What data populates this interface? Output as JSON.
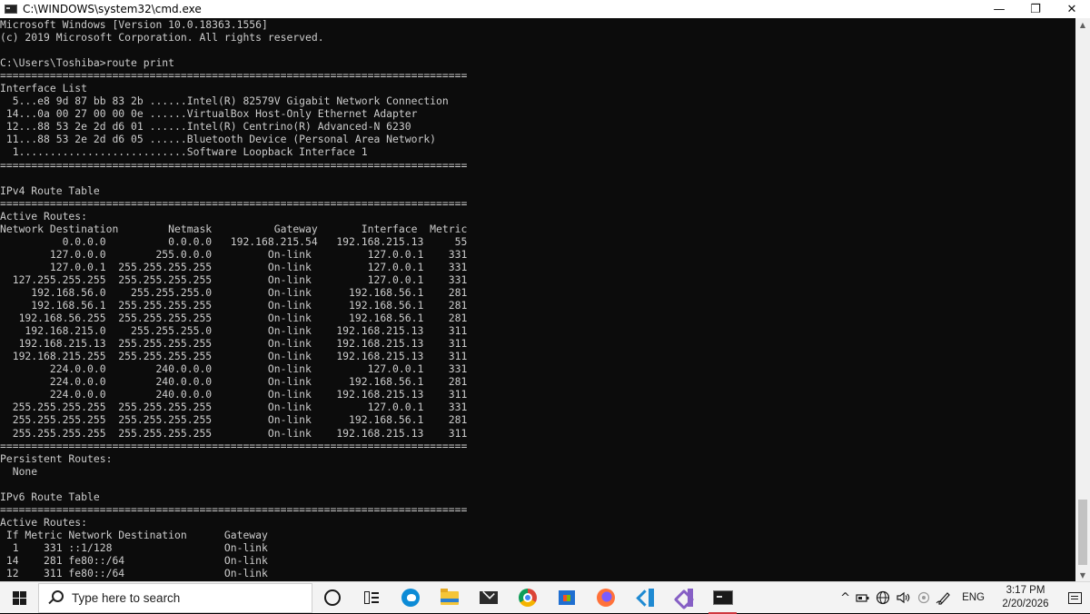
{
  "window": {
    "title": "C:\\WINDOWS\\system32\\cmd.exe",
    "controls": {
      "minimize": "—",
      "restore": "❐",
      "close": "✕"
    }
  },
  "console": {
    "lines": [
      "Microsoft Windows [Version 10.0.18363.1556]",
      "(c) 2019 Microsoft Corporation. All rights reserved.",
      "",
      "C:\\Users\\Toshiba>route print",
      "===========================================================================",
      "Interface List",
      "  5...e8 9d 87 bb 83 2b ......Intel(R) 82579V Gigabit Network Connection",
      " 14...0a 00 27 00 00 0e ......VirtualBox Host-Only Ethernet Adapter",
      " 12...88 53 2e 2d d6 01 ......Intel(R) Centrino(R) Advanced-N 6230",
      " 11...88 53 2e 2d d6 05 ......Bluetooth Device (Personal Area Network)",
      "  1...........................Software Loopback Interface 1",
      "===========================================================================",
      "",
      "IPv4 Route Table",
      "===========================================================================",
      "Active Routes:",
      "Network Destination        Netmask          Gateway       Interface  Metric",
      "          0.0.0.0          0.0.0.0   192.168.215.54   192.168.215.13     55",
      "        127.0.0.0        255.0.0.0         On-link         127.0.0.1    331",
      "        127.0.0.1  255.255.255.255         On-link         127.0.0.1    331",
      "  127.255.255.255  255.255.255.255         On-link         127.0.0.1    331",
      "     192.168.56.0    255.255.255.0         On-link      192.168.56.1    281",
      "     192.168.56.1  255.255.255.255         On-link      192.168.56.1    281",
      "   192.168.56.255  255.255.255.255         On-link      192.168.56.1    281",
      "    192.168.215.0    255.255.255.0         On-link    192.168.215.13    311",
      "   192.168.215.13  255.255.255.255         On-link    192.168.215.13    311",
      "  192.168.215.255  255.255.255.255         On-link    192.168.215.13    311",
      "        224.0.0.0        240.0.0.0         On-link         127.0.0.1    331",
      "        224.0.0.0        240.0.0.0         On-link      192.168.56.1    281",
      "        224.0.0.0        240.0.0.0         On-link    192.168.215.13    311",
      "  255.255.255.255  255.255.255.255         On-link         127.0.0.1    331",
      "  255.255.255.255  255.255.255.255         On-link      192.168.56.1    281",
      "  255.255.255.255  255.255.255.255         On-link    192.168.215.13    311",
      "===========================================================================",
      "Persistent Routes:",
      "  None",
      "",
      "IPv6 Route Table",
      "===========================================================================",
      "Active Routes:",
      " If Metric Network Destination      Gateway",
      "  1    331 ::1/128                  On-link",
      " 14    281 fe80::/64                On-link",
      " 12    311 fe80::/64                On-link"
    ]
  },
  "scrollbar": {
    "up_arrow": "▲",
    "down_arrow": "▼"
  },
  "taskbar": {
    "search_placeholder": "Type here to search",
    "pinned_apps": [
      "Cortana",
      "Task View",
      "Microsoft Edge",
      "File Explorer",
      "Mail",
      "Google Chrome",
      "Microsoft Store",
      "Firefox",
      "Visual Studio Code",
      "Visual Studio",
      "Command Prompt"
    ],
    "tray": {
      "chevron": "^",
      "language": "ENG",
      "time": "3:17 PM",
      "date": "2/20/2026"
    }
  },
  "colors": {
    "console_bg": "#0c0c0c",
    "console_fg": "#cccccc",
    "taskbar_bg": "#f3f3f3",
    "active_indicator": "#d0383f"
  }
}
